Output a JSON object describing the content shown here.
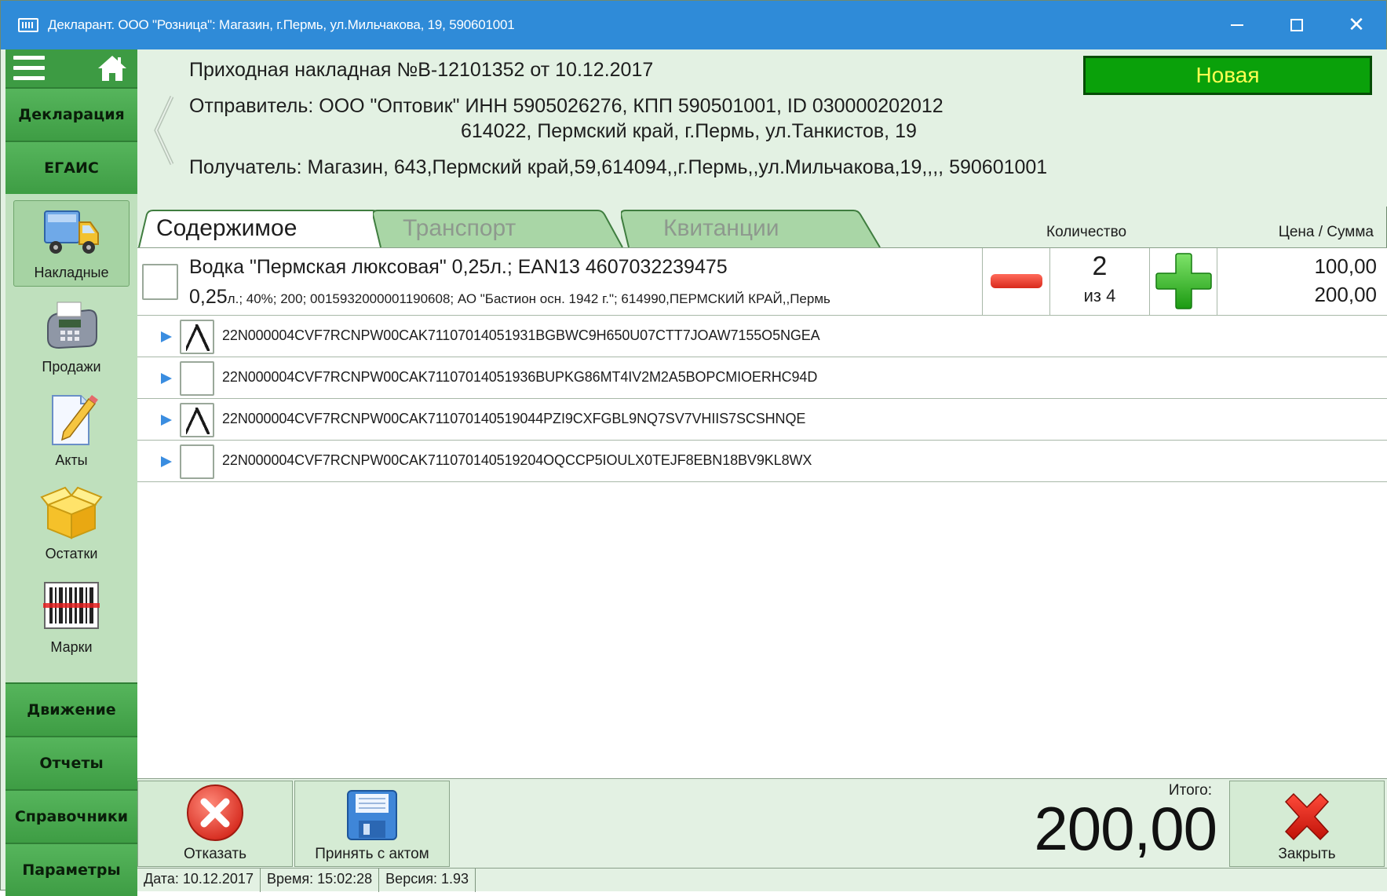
{
  "window": {
    "title": "Декларант. ООО \"Розница\": Магазин, г.Пермь, ул.Мильчакова, 19, 590601001"
  },
  "sidebar": {
    "top_sections": [
      "Декларация",
      "ЕГАИС"
    ],
    "items": [
      {
        "label": "Накладные",
        "icon": "truck-icon",
        "active": true
      },
      {
        "label": "Продажи",
        "icon": "payment-terminal-icon",
        "active": false
      },
      {
        "label": "Акты",
        "icon": "document-pencil-icon",
        "active": false
      },
      {
        "label": "Остатки",
        "icon": "box-icon",
        "active": false
      },
      {
        "label": "Марки",
        "icon": "barcode-icon",
        "active": false
      }
    ],
    "bottom_sections": [
      "Движение",
      "Отчеты",
      "Справочники",
      "Параметры"
    ]
  },
  "invoice": {
    "title": "Приходная накладная №В-12101352 от 10.12.2017",
    "sender_label": "Отправитель:",
    "sender_line1": "ООО \"Оптовик\" ИНН 5905026276, КПП 590501001, ID 030000202012",
    "sender_line2": "614022, Пермский край, г.Пермь, ул.Танкистов, 19",
    "receiver_label": "Получатель:",
    "receiver": "Магазин, 643,Пермский край,59,614094,,г.Пермь,,ул.Мильчакова,19,,,, 590601001",
    "status": "Новая"
  },
  "tabs": [
    {
      "label": "Содержимое",
      "active": true
    },
    {
      "label": "Транспорт",
      "active": false
    },
    {
      "label": "Квитанции",
      "active": false
    }
  ],
  "columns": {
    "quantity": "Количество",
    "price_sum": "Цена / Сумма"
  },
  "product": {
    "name": "Водка \"Пермская люксовая\" 0,25л.; EAN13 4607032239475",
    "details_volume": "0,25",
    "details_rest": "л.; 40%; 200; 0015932000001190608; АО \"Бастион осн. 1942 г.\"; 614990,ПЕРМСКИЙ КРАЙ,,Пермь",
    "qty": "2",
    "qty_of": "из 4",
    "price": "100,00",
    "sum": "200,00",
    "checked": false
  },
  "marks": [
    {
      "code": "22N000004CVF7RCNPW00CAK71107014051931BGBWC9H650U07CTT7JOAW7155O5NGEA",
      "checked": true
    },
    {
      "code": "22N000004CVF7RCNPW00CAK71107014051936BUPKG86MT4IV2M2A5BOPCMIOERHC94D",
      "checked": false
    },
    {
      "code": "22N000004CVF7RCNPW00CAK711070140519044PZI9CXFGBL9NQ7SV7VHIIS7SCSHNQE",
      "checked": true
    },
    {
      "code": "22N000004CVF7RCNPW00CAK711070140519204OQCCP5IOULX0TEJF8EBN18BV9KL8WX",
      "checked": false
    }
  ],
  "actions": {
    "reject": "Отказать",
    "accept_with_act": "Принять с актом",
    "close": "Закрыть"
  },
  "total": {
    "label": "Итого:",
    "value": "200,00"
  },
  "statusbar": {
    "date": "Дата: 10.12.2017",
    "time": "Время: 15:02:28",
    "version": "Версия: 1.93"
  },
  "colors": {
    "titlebar": "#2f8bd8",
    "nav_green": "#3e9d44",
    "status_badge_bg": "#0aa10a",
    "status_badge_text": "#ffff52",
    "background": "#e3f1e3"
  }
}
